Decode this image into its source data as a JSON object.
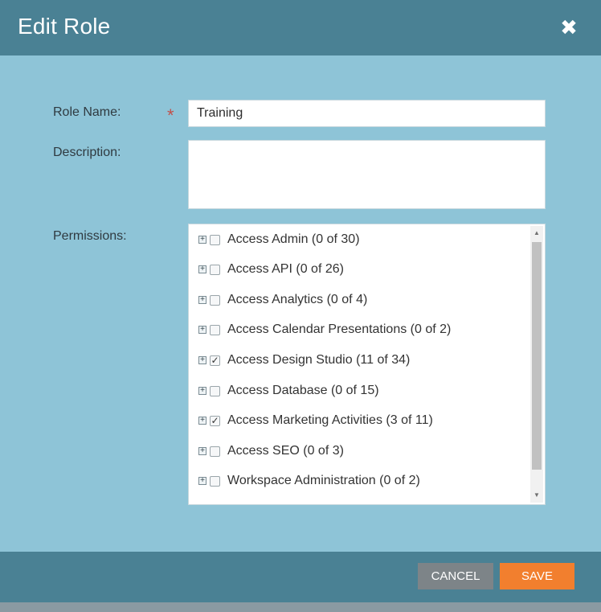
{
  "dialog": {
    "title": "Edit Role",
    "close_glyph": "✖"
  },
  "form": {
    "role_name_label": "Role Name:",
    "required_mark": "*",
    "role_name_value": "Training",
    "description_label": "Description:",
    "description_value": "",
    "permissions_label": "Permissions:"
  },
  "permissions": [
    {
      "label": "Access Admin (0 of 30)",
      "checked": false
    },
    {
      "label": "Access API (0 of 26)",
      "checked": false
    },
    {
      "label": "Access Analytics (0 of 4)",
      "checked": false
    },
    {
      "label": "Access Calendar Presentations (0 of 2)",
      "checked": false
    },
    {
      "label": "Access Design Studio (11 of 34)",
      "checked": true
    },
    {
      "label": "Access Database (0 of 15)",
      "checked": false,
      "highlighted": true
    },
    {
      "label": "Access Marketing Activities (3 of 11)",
      "checked": true
    },
    {
      "label": "Access SEO (0 of 3)",
      "checked": false
    },
    {
      "label": "Workspace Administration (0 of 2)",
      "checked": false
    }
  ],
  "buttons": {
    "cancel": "CANCEL",
    "save": "SAVE"
  },
  "colors": {
    "header": "#4a8194",
    "body": "#8ec4d7",
    "save": "#f27f2e",
    "cancel": "#7d8488",
    "highlight": "#f6ff3c",
    "required": "#c2504a"
  },
  "icons": {
    "close": "close-icon",
    "expander": "expand-plus-icon",
    "checkbox": "checkbox-icon"
  }
}
